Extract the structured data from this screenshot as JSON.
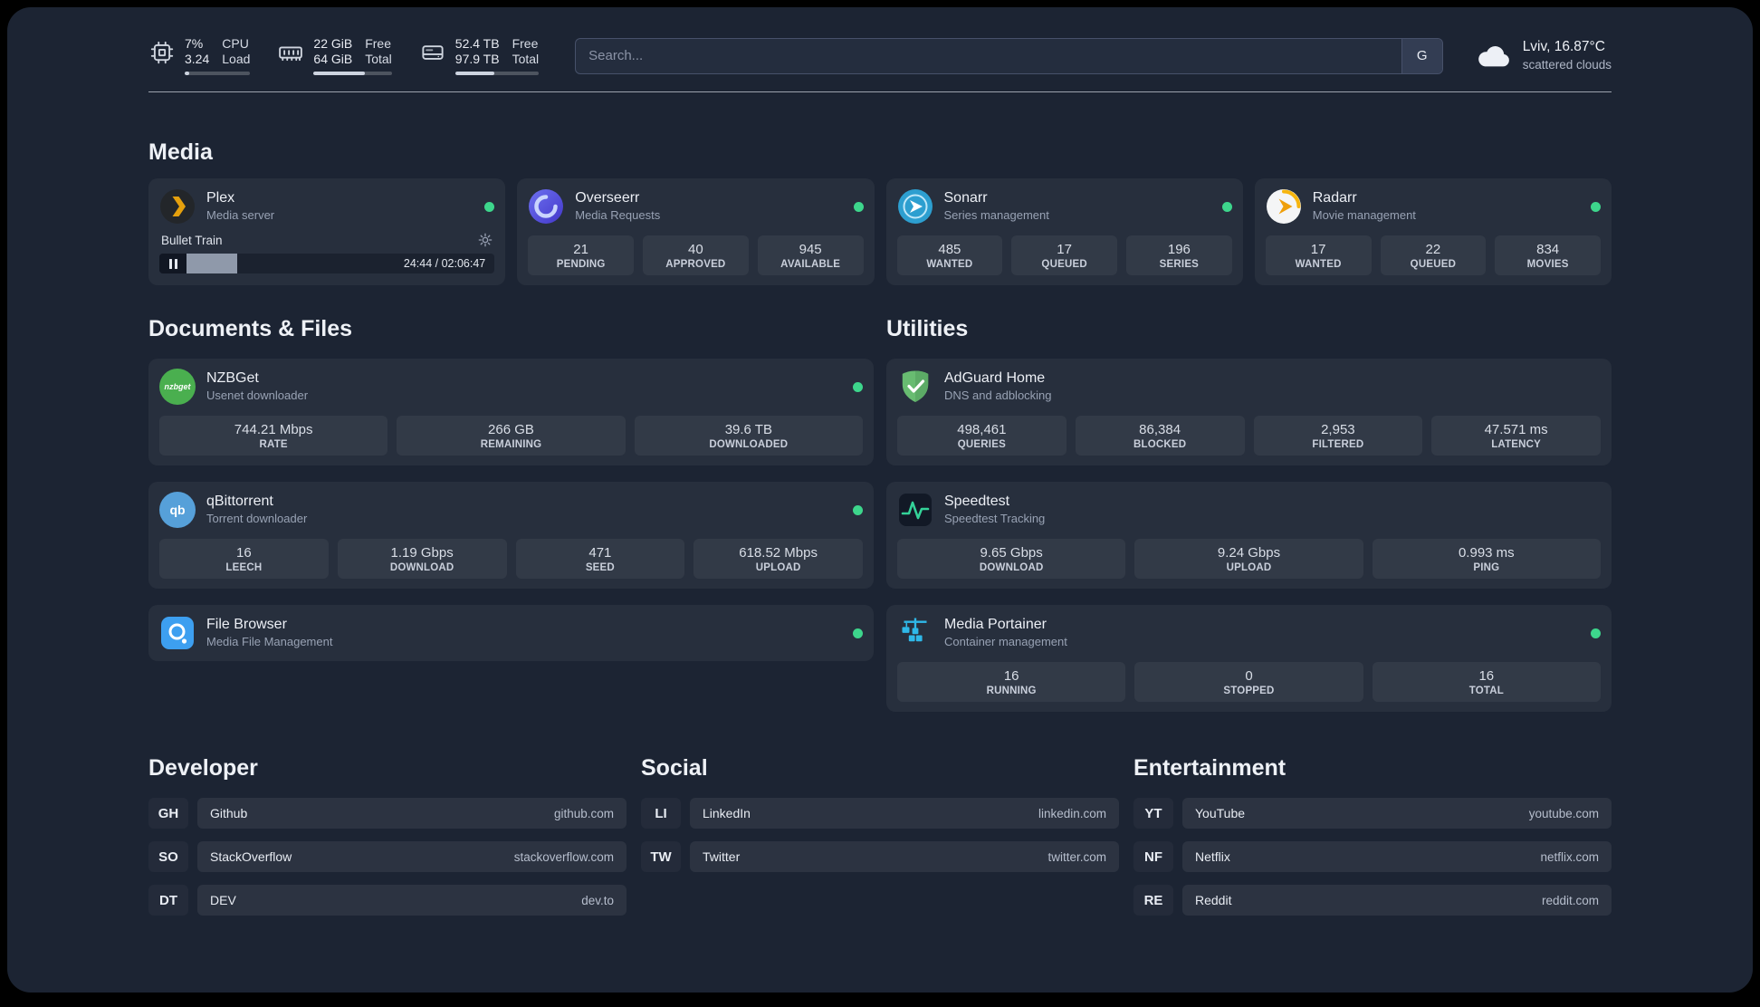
{
  "theme": {
    "background": "#1c2433",
    "status_green": "#3dd68c",
    "plex_accent": "#e5a00d"
  },
  "topbar": {
    "cpu": {
      "values": [
        "7%",
        "3.24"
      ],
      "labels": [
        "CPU",
        "Load"
      ],
      "bar_fill": "width:7%"
    },
    "memory": {
      "values": [
        "22 GiB",
        "64 GiB"
      ],
      "labels": [
        "Free",
        "Total"
      ],
      "bar_fill": "width:66%"
    },
    "disk": {
      "values": [
        "52.4 TB",
        "97.9 TB"
      ],
      "labels": [
        "Free",
        "Total"
      ],
      "bar_fill": "width:47%"
    },
    "search": {
      "placeholder": "Search...",
      "button_label": "G"
    },
    "weather": {
      "location": "Lviv, 16.87°C",
      "condition": "scattered clouds"
    }
  },
  "media": {
    "title": "Media",
    "plex": {
      "name": "Plex",
      "subtitle": "Media server",
      "now_playing": "Bullet Train",
      "time": "24:44 / 02:06:47",
      "progress": "width:15%"
    },
    "overseerr": {
      "name": "Overseerr",
      "subtitle": "Media Requests",
      "stats": [
        {
          "value": "21",
          "label": "PENDING"
        },
        {
          "value": "40",
          "label": "APPROVED"
        },
        {
          "value": "945",
          "label": "AVAILABLE"
        }
      ]
    },
    "sonarr": {
      "name": "Sonarr",
      "subtitle": "Series management",
      "stats": [
        {
          "value": "485",
          "label": "WANTED"
        },
        {
          "value": "17",
          "label": "QUEUED"
        },
        {
          "value": "196",
          "label": "SERIES"
        }
      ]
    },
    "radarr": {
      "name": "Radarr",
      "subtitle": "Movie management",
      "stats": [
        {
          "value": "17",
          "label": "WANTED"
        },
        {
          "value": "22",
          "label": "QUEUED"
        },
        {
          "value": "834",
          "label": "MOVIES"
        }
      ]
    }
  },
  "documents": {
    "title": "Documents & Files",
    "nzbget": {
      "name": "NZBGet",
      "subtitle": "Usenet downloader",
      "icon_text": "nzbget",
      "stats": [
        {
          "value": "744.21 Mbps",
          "label": "RATE"
        },
        {
          "value": "266 GB",
          "label": "REMAINING"
        },
        {
          "value": "39.6 TB",
          "label": "DOWNLOADED"
        }
      ]
    },
    "qbittorrent": {
      "name": "qBittorrent",
      "subtitle": "Torrent downloader",
      "icon_text": "qb",
      "stats": [
        {
          "value": "16",
          "label": "LEECH"
        },
        {
          "value": "1.19 Gbps",
          "label": "DOWNLOAD"
        },
        {
          "value": "471",
          "label": "SEED"
        },
        {
          "value": "618.52 Mbps",
          "label": "UPLOAD"
        }
      ]
    },
    "filebrowser": {
      "name": "File Browser",
      "subtitle": "Media File Management"
    }
  },
  "utilities": {
    "title": "Utilities",
    "adguard": {
      "name": "AdGuard Home",
      "subtitle": "DNS and adblocking",
      "stats": [
        {
          "value": "498,461",
          "label": "QUERIES"
        },
        {
          "value": "86,384",
          "label": "BLOCKED"
        },
        {
          "value": "2,953",
          "label": "FILTERED"
        },
        {
          "value": "47.571 ms",
          "label": "LATENCY"
        }
      ]
    },
    "speedtest": {
      "name": "Speedtest",
      "subtitle": "Speedtest Tracking",
      "stats": [
        {
          "value": "9.65 Gbps",
          "label": "DOWNLOAD"
        },
        {
          "value": "9.24 Gbps",
          "label": "UPLOAD"
        },
        {
          "value": "0.993 ms",
          "label": "PING"
        }
      ]
    },
    "portainer": {
      "name": "Media Portainer",
      "subtitle": "Container management",
      "stats": [
        {
          "value": "16",
          "label": "RUNNING"
        },
        {
          "value": "0",
          "label": "STOPPED"
        },
        {
          "value": "16",
          "label": "TOTAL"
        }
      ]
    }
  },
  "bookmarks": {
    "developer": {
      "title": "Developer",
      "items": [
        {
          "abbr": "GH",
          "name": "Github",
          "url": "github.com"
        },
        {
          "abbr": "SO",
          "name": "StackOverflow",
          "url": "stackoverflow.com"
        },
        {
          "abbr": "DT",
          "name": "DEV",
          "url": "dev.to"
        }
      ]
    },
    "social": {
      "title": "Social",
      "items": [
        {
          "abbr": "LI",
          "name": "LinkedIn",
          "url": "linkedin.com"
        },
        {
          "abbr": "TW",
          "name": "Twitter",
          "url": "twitter.com"
        }
      ]
    },
    "entertainment": {
      "title": "Entertainment",
      "items": [
        {
          "abbr": "YT",
          "name": "YouTube",
          "url": "youtube.com"
        },
        {
          "abbr": "NF",
          "name": "Netflix",
          "url": "netflix.com"
        },
        {
          "abbr": "RE",
          "name": "Reddit",
          "url": "reddit.com"
        }
      ]
    }
  }
}
